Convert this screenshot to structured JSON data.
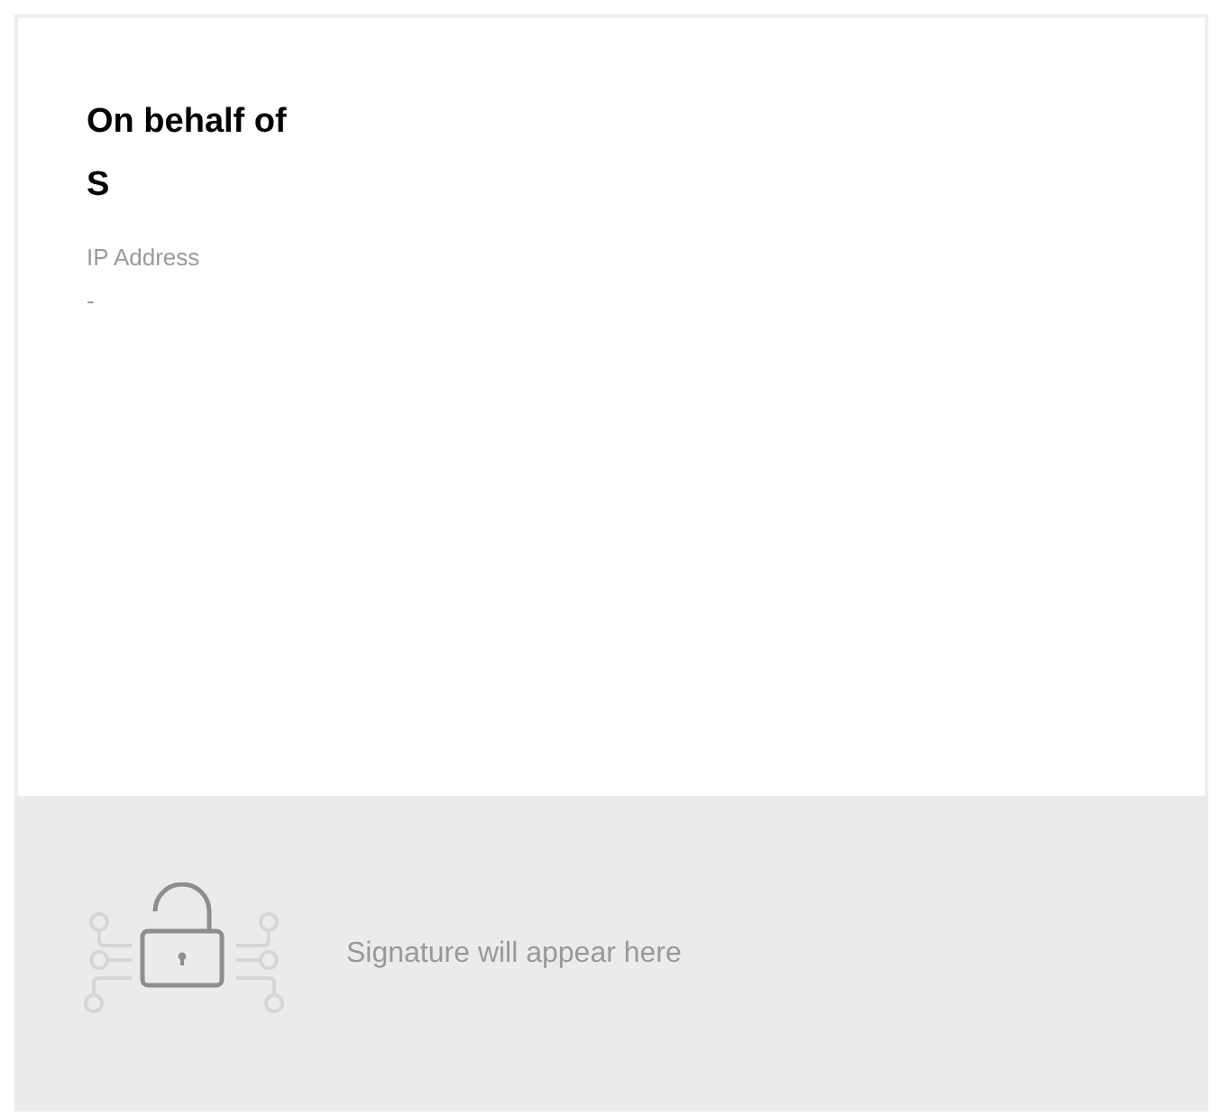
{
  "signer": {
    "title_lines": [
      "On behalf of",
      "S"
    ],
    "fields": [
      {
        "label": "IP Address",
        "value": "-"
      }
    ]
  },
  "signature_area": {
    "message": "Signature will appear here"
  }
}
